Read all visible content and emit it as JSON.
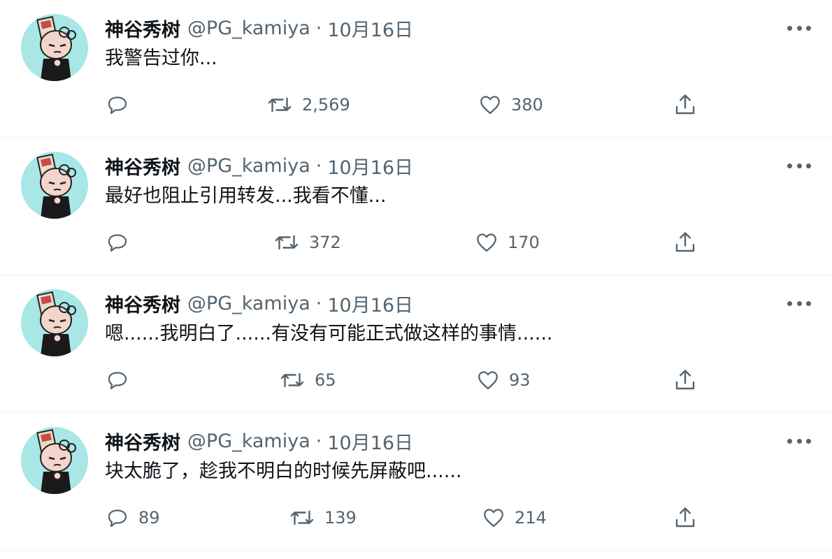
{
  "tweets": [
    {
      "name": "神谷秀树",
      "handle": "@PG_kamiya",
      "separator": "·",
      "date": "10月16日",
      "text": "我警告过你...",
      "reply_count": "",
      "retweet_count": "2,569",
      "like_count": "380"
    },
    {
      "name": "神谷秀树",
      "handle": "@PG_kamiya",
      "separator": "·",
      "date": "10月16日",
      "text": "最好也阻止引用转发...我看不懂...",
      "reply_count": "",
      "retweet_count": "372",
      "like_count": "170"
    },
    {
      "name": "神谷秀树",
      "handle": "@PG_kamiya",
      "separator": "·",
      "date": "10月16日",
      "text": "嗯......我明白了......有没有可能正式做这样的事情......",
      "reply_count": "",
      "retweet_count": "65",
      "like_count": "93"
    },
    {
      "name": "神谷秀树",
      "handle": "@PG_kamiya",
      "separator": "·",
      "date": "10月16日",
      "text": "块太脆了，趁我不明白的时候先屏蔽吧......",
      "reply_count": "89",
      "retweet_count": "139",
      "like_count": "214"
    }
  ],
  "icons": {
    "reply": "reply-icon",
    "retweet": "retweet-icon",
    "like": "heart-icon",
    "share": "share-icon",
    "more": "more-icon"
  },
  "colors": {
    "text": "#0f1419",
    "secondary": "#536471",
    "divider": "#eff3f4",
    "avatar_bg": "#a9e6e6"
  }
}
